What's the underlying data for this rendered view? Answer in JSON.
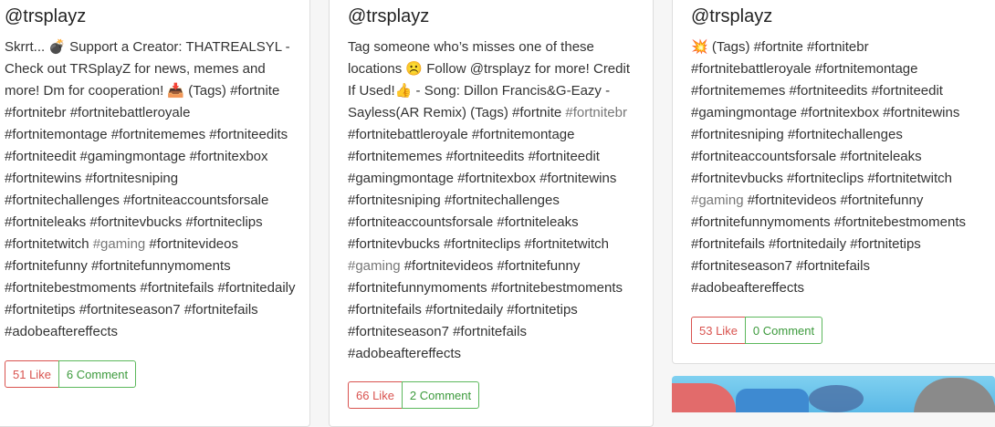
{
  "posts": [
    {
      "username": "@trsplayz",
      "caption_parts": [
        {
          "t": "Skrrt... 💣 Support a Creator: THATREALSYL - Check out TRSplayZ for news, memes and more! Dm for cooperation! 📥 (Tags) #fortnite #fortnitebr #fortnitebattleroyale #fortnitemontage #fortnitememes #fortniteedits #fortniteedit #gamingmontage #fortnitexbox #fortnitewins #fortnitesniping #fortnitechallenges #fortniteaccountsforsale #fortniteleaks #fortnitevbucks #fortniteclips #fortnitetwitch "
        },
        {
          "t": "#gaming",
          "muted": true
        },
        {
          "t": " #fortnitevideos #fortnitefunny #fortnitefunnymoments #fortnitebestmoments #fortnitefails #fortnitedaily #fortnitetips #fortniteseason7 #fortnitefails #adobeaftereffects"
        }
      ],
      "like_label": "51 Like",
      "comment_label": "6 Comment"
    },
    {
      "username": "@trsplayz",
      "caption_parts": [
        {
          "t": "Tag someone who’s misses one of these locations ☹️ Follow @trsplayz for more! Credit If Used!👍 - Song: Dillon Francis&G-Eazy - Sayless(AR Remix) (Tags) #fortnite "
        },
        {
          "t": "#fortnitebr",
          "muted": true
        },
        {
          "t": " #fortnitebattleroyale #fortnitemontage #fortnitememes #fortniteedits #fortniteedit #gamingmontage #fortnitexbox #fortnitewins #fortnitesniping #fortnitechallenges #fortniteaccountsforsale #fortniteleaks #fortnitevbucks #fortniteclips #fortnitetwitch "
        },
        {
          "t": "#gaming",
          "muted": true
        },
        {
          "t": " #fortnitevideos #fortnitefunny #fortnitefunnymoments #fortnitebestmoments #fortnitefails #fortnitedaily #fortnitetips #fortniteseason7 #fortnitefails #adobeaftereffects"
        }
      ],
      "like_label": "66 Like",
      "comment_label": "2 Comment"
    },
    {
      "username": "@trsplayz",
      "caption_parts": [
        {
          "t": "💥 (Tags) #fortnite #fortnitebr #fortnitebattleroyale #fortnitemontage #fortnitememes #fortniteedits #fortniteedit #gamingmontage #fortnitexbox #fortnitewins #fortnitesniping #fortnitechallenges #fortniteaccountsforsale #fortniteleaks #fortnitevbucks #fortniteclips #fortnitetwitch "
        },
        {
          "t": "#gaming",
          "muted": true
        },
        {
          "t": " #fortnitevideos #fortnitefunny #fortnitefunnymoments #fortnitebestmoments #fortnitefails #fortnitedaily #fortnitetips #fortniteseason7 #fortnitefails #adobeaftereffects"
        }
      ],
      "like_label": "53 Like",
      "comment_label": "0 Comment"
    }
  ],
  "colors": {
    "like": "#d9534f",
    "comment": "#5cb85c",
    "hashtag_muted": "#777777"
  }
}
